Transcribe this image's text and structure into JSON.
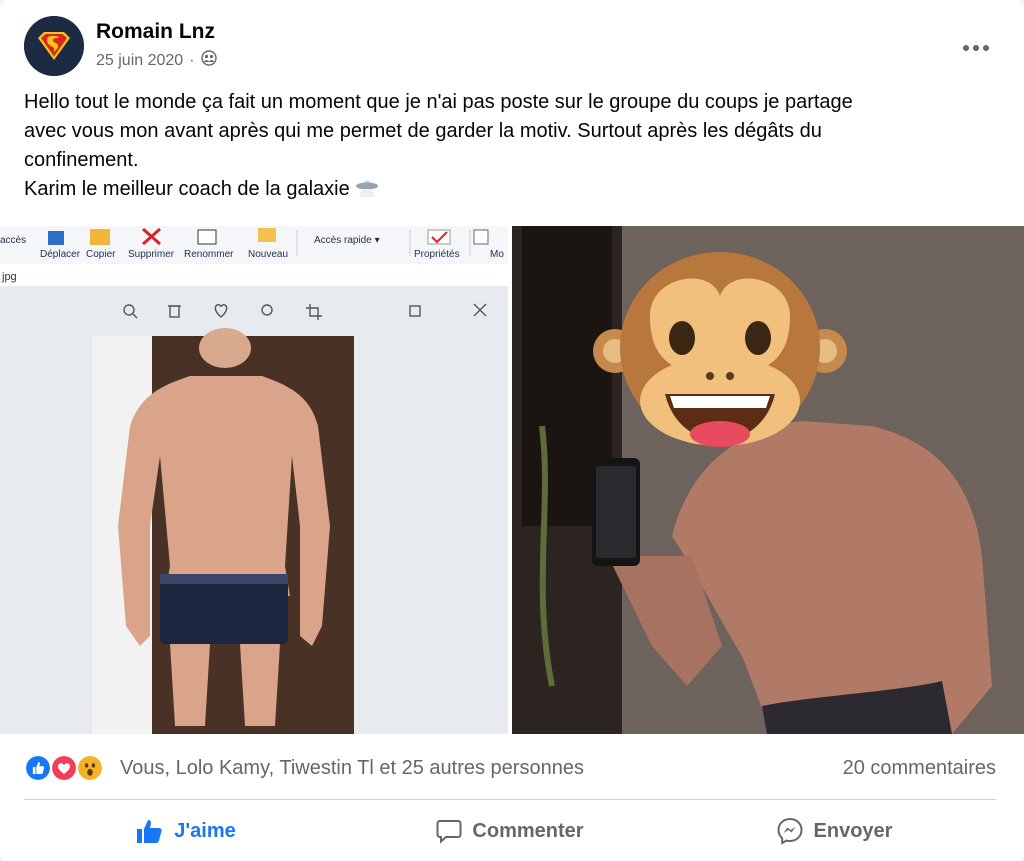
{
  "author": {
    "name": "Romain Lnz",
    "date": "25 juin 2020",
    "audience_icon": "friends-icon"
  },
  "post": {
    "text": "Hello tout le monde ça fait un moment que je n'ai pas poste sur le groupe du coups je partage\navec vous mon avant après qui me permet de garder la motiv. Surtout après les dégâts du\nconfinement.\nKarim le meilleur coach de la galaxie",
    "trailing_emoji": "ufo-icon"
  },
  "photo_left": {
    "ribbon": {
      "items": [
        "accès",
        "Déplacer",
        "Copier",
        "Supprimer",
        "Renommer",
        "Nouveau",
        "Accès rapide ▾",
        "Propriétés",
        "Mo"
      ],
      "filename": "jpg"
    }
  },
  "reactions": {
    "icons": [
      "like-icon",
      "love-icon",
      "wow-icon"
    ],
    "names": "Vous, Lolo Kamy, Tiwestin Tl et 25 autres personnes",
    "comments": "20 commentaires"
  },
  "actions": {
    "like": "J'aime",
    "comment": "Commenter",
    "share": "Envoyer"
  },
  "colors": {
    "accent": "#1877f2",
    "secondary_text": "#65676b",
    "love": "#f33e58",
    "wow": "#f7b125"
  }
}
